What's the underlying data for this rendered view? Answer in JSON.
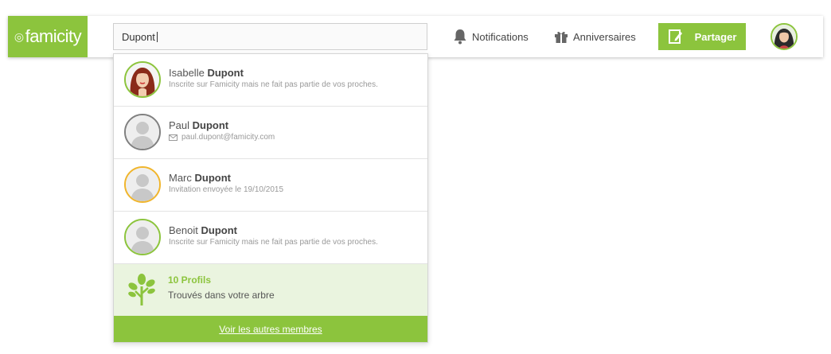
{
  "logo": {
    "text": "famicity"
  },
  "search": {
    "value": "Dupont"
  },
  "nav": {
    "notifications": "Notifications",
    "anniversaires": "Anniversaires",
    "share": "Partager"
  },
  "results": [
    {
      "first": "Isabelle",
      "last": "Dupont",
      "sub": "Inscrite sur Famicity mais ne fait pas partie de vos proches.",
      "ring": "#8cc43d"
    },
    {
      "first": "Paul",
      "last": "Dupont",
      "sub": "paul.dupont@famicity.com",
      "ring": "#808080"
    },
    {
      "first": "Marc",
      "last": "Dupont",
      "sub": "Invitation envoyée le 19/10/2015",
      "ring": "#f0b52c"
    },
    {
      "first": "Benoit",
      "last": "Dupont",
      "sub": "Inscrite sur Famicity mais ne fait pas partie de vos proches.",
      "ring": "#8cc43d"
    }
  ],
  "tree": {
    "count": "10 Profils",
    "desc": "Trouvés dans votre arbre"
  },
  "more": {
    "label": "Voir les autres membres"
  },
  "colors": {
    "accent": "#8cc43d"
  }
}
